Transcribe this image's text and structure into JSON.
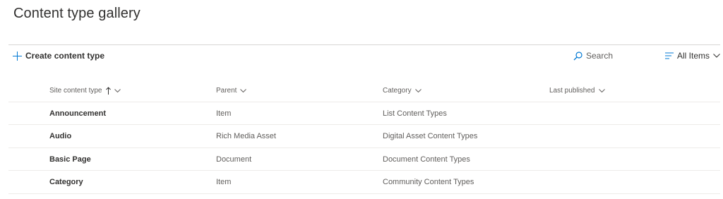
{
  "page": {
    "title": "Content type gallery"
  },
  "commandbar": {
    "create_label": "Create content type",
    "search_placeholder": "Search",
    "view_label": "All Items"
  },
  "table": {
    "columns": [
      {
        "label": "Site content type",
        "sorted": "ascending"
      },
      {
        "label": "Parent"
      },
      {
        "label": "Category"
      },
      {
        "label": "Last published"
      }
    ],
    "rows": [
      {
        "name": "Announcement",
        "parent": "Item",
        "category": "List Content Types",
        "last_published": ""
      },
      {
        "name": "Audio",
        "parent": "Rich Media Asset",
        "category": "Digital Asset Content Types",
        "last_published": ""
      },
      {
        "name": "Basic Page",
        "parent": "Document",
        "category": "Document Content Types",
        "last_published": ""
      },
      {
        "name": "Category",
        "parent": "Item",
        "category": "Community Content Types",
        "last_published": ""
      }
    ]
  },
  "colors": {
    "accent": "#0078d4",
    "text": "#323130",
    "secondary_text": "#605e5c",
    "divider": "#edebe9"
  }
}
